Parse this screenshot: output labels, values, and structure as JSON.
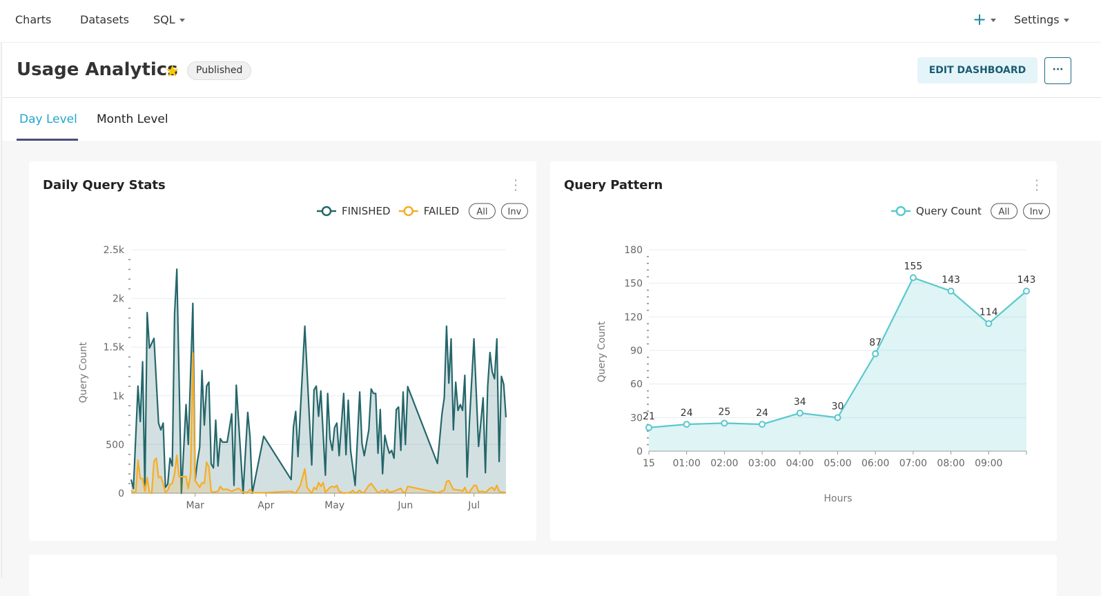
{
  "nav": {
    "items": [
      {
        "label": "Charts"
      },
      {
        "label": "Datasets"
      },
      {
        "label": "SQL"
      }
    ],
    "plus_icon": "plus-icon",
    "settings": "Settings"
  },
  "header": {
    "title": "Usage Analytics",
    "star_icon": "star-icon",
    "status": "Published",
    "edit_label": "EDIT DASHBOARD",
    "more_label": "···"
  },
  "tabs": [
    {
      "label": "Day Level",
      "active": true
    },
    {
      "label": "Month Level",
      "active": false
    }
  ],
  "colors": {
    "accent": "#20a7c9",
    "finished": "#24666a",
    "failed": "#f5ad28",
    "query_count": "#5ac8cc"
  },
  "chart_data": [
    {
      "type": "area",
      "title": "Daily Query Stats",
      "ylabel": "Query Count",
      "xlabel": "",
      "ylim": [
        0,
        2500
      ],
      "yticks": [
        "0",
        "500",
        "1k",
        "1.5k",
        "2k",
        "2.5k"
      ],
      "xticks": [
        {
          "date": "03-01",
          "label": "Mar"
        },
        {
          "date": "04-01",
          "label": "Apr"
        },
        {
          "date": "05-01",
          "label": "May"
        },
        {
          "date": "06-01",
          "label": "Jun"
        },
        {
          "date": "07-01",
          "label": "Jul"
        }
      ],
      "xrange": [
        "02-01",
        "07-15"
      ],
      "grid": true,
      "legend": {
        "placement": "top-right",
        "controls": [
          "All",
          "Inv"
        ]
      },
      "series": [
        {
          "name": "FINISHED",
          "points": [
            [
              "02-01",
              140
            ],
            [
              "02-02",
              47
            ],
            [
              "02-04",
              1100
            ],
            [
              "02-05",
              735
            ],
            [
              "02-06",
              1350
            ],
            [
              "02-07",
              25
            ],
            [
              "02-08",
              1855
            ],
            [
              "02-09",
              1490
            ],
            [
              "02-11",
              1590
            ],
            [
              "02-13",
              720
            ],
            [
              "02-14",
              650
            ],
            [
              "02-15",
              720
            ],
            [
              "02-16",
              60
            ],
            [
              "02-17",
              95
            ],
            [
              "02-18",
              360
            ],
            [
              "02-19",
              280
            ],
            [
              "02-20",
              1840
            ],
            [
              "02-21",
              2300
            ],
            [
              "02-23",
              0
            ],
            [
              "02-25",
              910
            ],
            [
              "02-26",
              500
            ],
            [
              "02-28",
              1950
            ],
            [
              "03-01",
              130
            ],
            [
              "03-02",
              330
            ],
            [
              "03-03",
              470
            ],
            [
              "03-04",
              1260
            ],
            [
              "03-05",
              700
            ],
            [
              "03-06",
              1100
            ],
            [
              "03-07",
              1140
            ],
            [
              "03-08",
              300
            ],
            [
              "03-09",
              260
            ],
            [
              "03-10",
              750
            ],
            [
              "03-11",
              280
            ],
            [
              "03-12",
              560
            ],
            [
              "03-13",
              525
            ],
            [
              "03-15",
              525
            ],
            [
              "03-17",
              815
            ],
            [
              "03-18",
              80
            ],
            [
              "03-19",
              1110
            ],
            [
              "03-22",
              0
            ],
            [
              "03-24",
              830
            ],
            [
              "03-25",
              580
            ],
            [
              "03-26",
              0
            ],
            [
              "03-31",
              585
            ],
            [
              "04-12",
              140
            ],
            [
              "04-13",
              680
            ],
            [
              "04-14",
              840
            ],
            [
              "04-15",
              375
            ],
            [
              "04-18",
              1715
            ],
            [
              "04-21",
              290
            ],
            [
              "04-22",
              1060
            ],
            [
              "04-23",
              1100
            ],
            [
              "04-24",
              790
            ],
            [
              "04-25",
              1050
            ],
            [
              "04-27",
              185
            ],
            [
              "04-28",
              1025
            ],
            [
              "04-29",
              560
            ],
            [
              "04-30",
              440
            ],
            [
              "05-01",
              675
            ],
            [
              "05-02",
              720
            ],
            [
              "05-03",
              385
            ],
            [
              "05-05",
              1025
            ],
            [
              "05-06",
              395
            ],
            [
              "05-07",
              955
            ],
            [
              "05-08",
              440
            ],
            [
              "05-10",
              80
            ],
            [
              "05-12",
              1040
            ],
            [
              "05-13",
              510
            ],
            [
              "05-14",
              385
            ],
            [
              "05-16",
              650
            ],
            [
              "05-17",
              1070
            ],
            [
              "05-18",
              1025
            ],
            [
              "05-19",
              1025
            ],
            [
              "05-20",
              410
            ],
            [
              "05-21",
              860
            ],
            [
              "05-22",
              200
            ],
            [
              "05-23",
              595
            ],
            [
              "05-24",
              490
            ],
            [
              "05-25",
              410
            ],
            [
              "05-26",
              440
            ],
            [
              "05-27",
              360
            ],
            [
              "05-28",
              860
            ],
            [
              "05-29",
              885
            ],
            [
              "05-30",
              440
            ],
            [
              "05-31",
              1040
            ],
            [
              "06-01",
              500
            ],
            [
              "06-02",
              1095
            ],
            [
              "06-15",
              305
            ],
            [
              "06-17",
              815
            ],
            [
              "06-18",
              980
            ],
            [
              "06-19",
              1715
            ],
            [
              "06-20",
              1130
            ],
            [
              "06-21",
              1585
            ],
            [
              "06-22",
              650
            ],
            [
              "06-23",
              1140
            ],
            [
              "06-24",
              850
            ],
            [
              "06-25",
              910
            ],
            [
              "06-26",
              850
            ],
            [
              "06-27",
              1210
            ],
            [
              "06-28",
              165
            ],
            [
              "06-29",
              720
            ],
            [
              "07-01",
              1585
            ],
            [
              "07-03",
              480
            ],
            [
              "07-05",
              980
            ],
            [
              "07-06",
              210
            ],
            [
              "07-07",
              1095
            ],
            [
              "07-08",
              1445
            ],
            [
              "07-09",
              1245
            ],
            [
              "07-10",
              1175
            ],
            [
              "07-11",
              1585
            ],
            [
              "07-12",
              325
            ],
            [
              "07-13",
              1200
            ],
            [
              "07-14",
              1120
            ],
            [
              "07-15",
              780
            ]
          ]
        },
        {
          "name": "FAILED",
          "points": [
            [
              "02-01",
              30
            ],
            [
              "02-02",
              10
            ],
            [
              "02-03",
              5
            ],
            [
              "02-04",
              340
            ],
            [
              "02-05",
              150
            ],
            [
              "02-06",
              150
            ],
            [
              "02-07",
              20
            ],
            [
              "02-08",
              160
            ],
            [
              "02-09",
              5
            ],
            [
              "02-10",
              0
            ],
            [
              "02-11",
              330
            ],
            [
              "02-12",
              360
            ],
            [
              "02-13",
              160
            ],
            [
              "02-14",
              170
            ],
            [
              "02-15",
              100
            ],
            [
              "02-16",
              10
            ],
            [
              "02-17",
              30
            ],
            [
              "02-18",
              90
            ],
            [
              "02-19",
              100
            ],
            [
              "02-20",
              200
            ],
            [
              "02-21",
              390
            ],
            [
              "02-22",
              170
            ],
            [
              "02-25",
              170
            ],
            [
              "02-26",
              50
            ],
            [
              "02-27",
              200
            ],
            [
              "02-28",
              1440
            ],
            [
              "03-01",
              130
            ],
            [
              "03-03",
              60
            ],
            [
              "03-04",
              110
            ],
            [
              "03-05",
              100
            ],
            [
              "03-06",
              320
            ],
            [
              "03-07",
              270
            ],
            [
              "03-08",
              20
            ],
            [
              "03-09",
              10
            ],
            [
              "03-11",
              20
            ],
            [
              "03-12",
              70
            ],
            [
              "03-13",
              40
            ],
            [
              "03-15",
              40
            ],
            [
              "03-17",
              20
            ],
            [
              "03-20",
              50
            ],
            [
              "03-22",
              10
            ],
            [
              "03-24",
              10
            ],
            [
              "03-25",
              40
            ],
            [
              "03-26",
              5
            ],
            [
              "03-31",
              5
            ],
            [
              "04-12",
              20
            ],
            [
              "04-14",
              0
            ],
            [
              "04-16",
              80
            ],
            [
              "04-18",
              250
            ],
            [
              "04-19",
              60
            ],
            [
              "04-21",
              0
            ],
            [
              "04-22",
              60
            ],
            [
              "04-23",
              40
            ],
            [
              "04-24",
              110
            ],
            [
              "04-25",
              70
            ],
            [
              "04-26",
              110
            ],
            [
              "04-27",
              10
            ],
            [
              "04-29",
              60
            ],
            [
              "04-30",
              70
            ],
            [
              "05-01",
              60
            ],
            [
              "05-02",
              80
            ],
            [
              "05-03",
              20
            ],
            [
              "05-05",
              0
            ],
            [
              "05-07",
              5
            ],
            [
              "05-08",
              10
            ],
            [
              "05-09",
              30
            ],
            [
              "05-10",
              0
            ],
            [
              "05-12",
              30
            ],
            [
              "05-13",
              5
            ],
            [
              "05-14",
              10
            ],
            [
              "05-16",
              80
            ],
            [
              "05-17",
              100
            ],
            [
              "05-18",
              70
            ],
            [
              "05-20",
              5
            ],
            [
              "05-22",
              30
            ],
            [
              "05-23",
              10
            ],
            [
              "05-24",
              40
            ],
            [
              "05-25",
              10
            ],
            [
              "05-27",
              20
            ],
            [
              "05-30",
              50
            ],
            [
              "05-31",
              10
            ],
            [
              "06-01",
              10
            ],
            [
              "06-02",
              70
            ],
            [
              "06-15",
              5
            ],
            [
              "06-18",
              30
            ],
            [
              "06-19",
              120
            ],
            [
              "06-20",
              130
            ],
            [
              "06-22",
              40
            ],
            [
              "06-25",
              30
            ],
            [
              "06-26",
              20
            ],
            [
              "06-27",
              60
            ],
            [
              "06-28",
              5
            ],
            [
              "06-29",
              10
            ],
            [
              "07-01",
              80
            ],
            [
              "07-02",
              80
            ],
            [
              "07-03",
              15
            ],
            [
              "07-05",
              20
            ],
            [
              "07-06",
              5
            ],
            [
              "07-08",
              50
            ],
            [
              "07-09",
              60
            ],
            [
              "07-10",
              30
            ],
            [
              "07-11",
              80
            ],
            [
              "07-12",
              20
            ],
            [
              "07-13",
              10
            ],
            [
              "07-14",
              10
            ],
            [
              "07-15",
              5
            ]
          ]
        }
      ]
    },
    {
      "type": "area",
      "title": "Query Pattern",
      "ylabel": "Query Count",
      "xlabel": "Hours",
      "ylim": [
        0,
        180
      ],
      "yticks": [
        "0",
        "30",
        "60",
        "90",
        "120",
        "150",
        "180"
      ],
      "categories": [
        "15",
        "01:00",
        "02:00",
        "03:00",
        "04:00",
        "05:00",
        "06:00",
        "07:00",
        "08:00",
        "09:00",
        ""
      ],
      "grid": true,
      "legend": {
        "placement": "top-right",
        "controls": [
          "All",
          "Inv"
        ]
      },
      "series": [
        {
          "name": "Query Count",
          "values": [
            21,
            24,
            25,
            24,
            34,
            30,
            87,
            155,
            143,
            114,
            143
          ]
        }
      ]
    }
  ]
}
